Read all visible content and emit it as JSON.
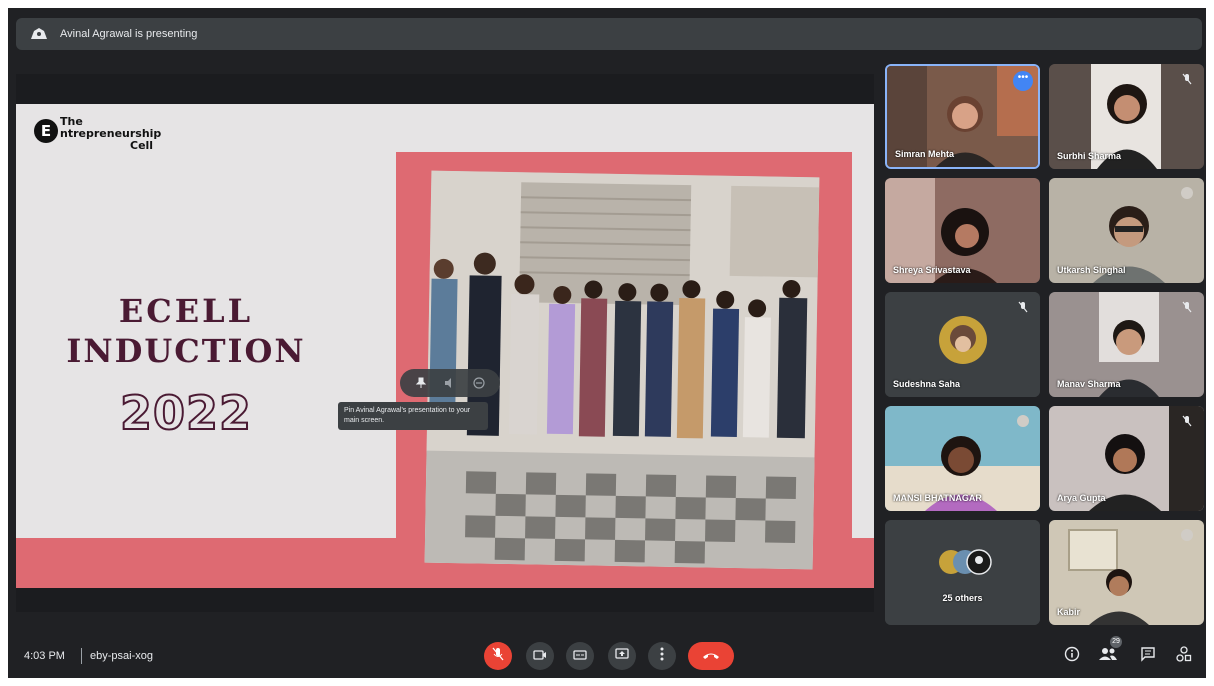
{
  "window": {
    "title": "Avinal Agrawal is presenting"
  },
  "presentation": {
    "logo": {
      "badge": "E",
      "line1": "The",
      "line2": "ntrepreneurship",
      "line3": "Cell"
    },
    "title_line1": "ECELL",
    "title_line2": "INDUCTION",
    "year": "2022"
  },
  "pin_tooltip": "Pin Avinal Agrawal's presentation to your main screen.",
  "participants": [
    {
      "name": "Simran Mehta",
      "bg": "#7a5a4a",
      "more": "•••"
    },
    {
      "name": "Surbhi Sharma",
      "bg": "#5a4f4a"
    },
    {
      "name": "Shreya Srivastava",
      "bg": "#8e6b62"
    },
    {
      "name": "Utkarsh Singhal",
      "bg": "#b8b2a6"
    },
    {
      "name": "Sudeshna Saha",
      "bg": "#3c4043"
    },
    {
      "name": "Manav Sharma",
      "bg": "#9a9190"
    },
    {
      "name": "MANSI BHATNAGAR",
      "bg": "#7fb8c9"
    },
    {
      "name": "Arya Gupta",
      "bg": "#c9c1bf"
    },
    {
      "name": "25 others",
      "bg": "#3c4043"
    },
    {
      "name": "Kabir",
      "bg": "#cfc7b6"
    }
  ],
  "footer": {
    "time": "4:03 PM",
    "meeting_code": "eby-psai-xog",
    "people_count": "29"
  },
  "icons": {
    "mic": "mic-off-icon",
    "camera": "camera-icon",
    "captions": "captions-icon",
    "present": "present-screen-icon",
    "more": "more-options-icon",
    "hangup": "hang-up-icon",
    "info": "info-icon",
    "people": "people-icon",
    "chat": "chat-icon",
    "activities": "activities-icon"
  },
  "colors": {
    "background": "#202124",
    "surface": "#3c4043",
    "danger": "#ea4335",
    "accent": "#4285f4",
    "slide_pink": "#de6a72",
    "slide_title": "#4a1a33"
  }
}
